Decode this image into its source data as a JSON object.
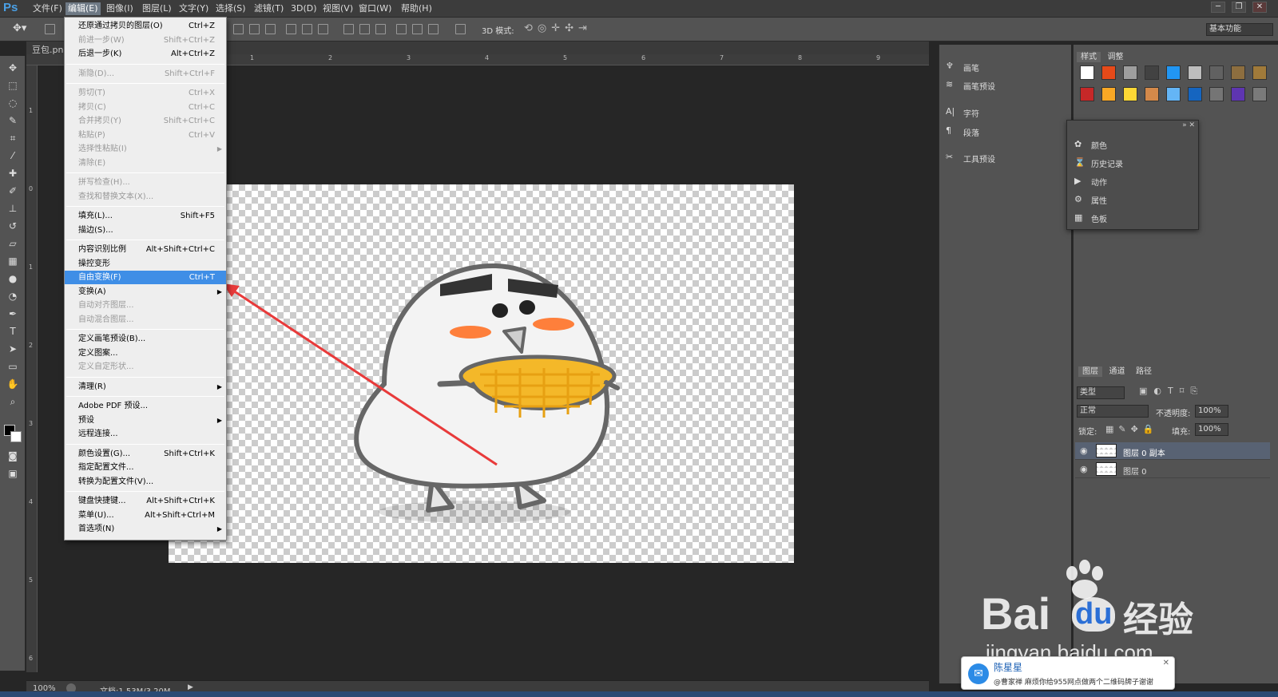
{
  "menubar": {
    "logo": "Ps",
    "items": [
      "文件(F)",
      "编辑(E)",
      "图像(I)",
      "图层(L)",
      "文字(Y)",
      "选择(S)",
      "滤镜(T)",
      "3D(D)",
      "视图(V)",
      "窗口(W)",
      "帮助(H)"
    ],
    "active_index": 1,
    "window_buttons": [
      "─",
      "❐",
      "✕"
    ]
  },
  "optbar": {
    "mode_label": "3D 模式:",
    "workspace": "基本功能"
  },
  "document": {
    "tab": "豆包.png",
    "zoom": "100%",
    "doc_info": "文档:1.53M/3.20M"
  },
  "ruler": {
    "top_marks": [
      "1",
      "2",
      "3",
      "4",
      "5",
      "6",
      "7",
      "8",
      "9"
    ],
    "left_marks": [
      "1",
      "0",
      "1",
      "2",
      "3",
      "4",
      "5",
      "6"
    ]
  },
  "edit_menu": {
    "items": [
      {
        "label": "还原通过拷贝的图层(O)",
        "shortcut": "Ctrl+Z",
        "enabled": true
      },
      {
        "label": "前进一步(W)",
        "shortcut": "Shift+Ctrl+Z",
        "enabled": false
      },
      {
        "label": "后退一步(K)",
        "shortcut": "Alt+Ctrl+Z",
        "enabled": true
      },
      {
        "label": "渐隐(D)...",
        "shortcut": "Shift+Ctrl+F",
        "enabled": false
      },
      {
        "label": "剪切(T)",
        "shortcut": "Ctrl+X",
        "enabled": false
      },
      {
        "label": "拷贝(C)",
        "shortcut": "Ctrl+C",
        "enabled": false
      },
      {
        "label": "合并拷贝(Y)",
        "shortcut": "Shift+Ctrl+C",
        "enabled": false
      },
      {
        "label": "粘贴(P)",
        "shortcut": "Ctrl+V",
        "enabled": false
      },
      {
        "label": "选择性粘贴(I)",
        "shortcut": "",
        "enabled": false,
        "submenu": true
      },
      {
        "label": "清除(E)",
        "shortcut": "",
        "enabled": false
      },
      {
        "label": "拼写检查(H)...",
        "shortcut": "",
        "enabled": false
      },
      {
        "label": "查找和替换文本(X)...",
        "shortcut": "",
        "enabled": false
      },
      {
        "label": "填充(L)...",
        "shortcut": "Shift+F5",
        "enabled": true
      },
      {
        "label": "描边(S)...",
        "shortcut": "",
        "enabled": true
      },
      {
        "label": "内容识别比例",
        "shortcut": "Alt+Shift+Ctrl+C",
        "enabled": true
      },
      {
        "label": "操控变形",
        "shortcut": "",
        "enabled": true
      },
      {
        "label": "自由变换(F)",
        "shortcut": "Ctrl+T",
        "enabled": true,
        "highlighted": true
      },
      {
        "label": "变换(A)",
        "shortcut": "",
        "enabled": true,
        "submenu": true
      },
      {
        "label": "自动对齐图层...",
        "shortcut": "",
        "enabled": false
      },
      {
        "label": "自动混合图层...",
        "shortcut": "",
        "enabled": false
      },
      {
        "label": "定义画笔预设(B)...",
        "shortcut": "",
        "enabled": true
      },
      {
        "label": "定义图案...",
        "shortcut": "",
        "enabled": true
      },
      {
        "label": "定义自定形状...",
        "shortcut": "",
        "enabled": false
      },
      {
        "label": "清理(R)",
        "shortcut": "",
        "enabled": true,
        "submenu": true
      },
      {
        "label": "Adobe PDF 预设...",
        "shortcut": "",
        "enabled": true
      },
      {
        "label": "预设",
        "shortcut": "",
        "enabled": true,
        "submenu": true
      },
      {
        "label": "远程连接...",
        "shortcut": "",
        "enabled": true
      },
      {
        "label": "颜色设置(G)...",
        "shortcut": "Shift+Ctrl+K",
        "enabled": true
      },
      {
        "label": "指定配置文件...",
        "shortcut": "",
        "enabled": true
      },
      {
        "label": "转换为配置文件(V)...",
        "shortcut": "",
        "enabled": true
      },
      {
        "label": "键盘快捷键...",
        "shortcut": "Alt+Shift+Ctrl+K",
        "enabled": true
      },
      {
        "label": "菜单(U)...",
        "shortcut": "Alt+Shift+Ctrl+M",
        "enabled": true
      },
      {
        "label": "首选项(N)",
        "shortcut": "",
        "enabled": true,
        "submenu": true
      }
    ]
  },
  "mid_panel": {
    "items": [
      "画笔",
      "画笔预设",
      "字符",
      "段落",
      "工具预设"
    ]
  },
  "styles_panel": {
    "tabs": [
      "样式",
      "调整"
    ]
  },
  "float_panel": {
    "items": [
      "颜色",
      "历史记录",
      "动作",
      "属性",
      "色板"
    ]
  },
  "layers_panel": {
    "tabs": [
      "图层",
      "通道",
      "路径"
    ],
    "filter": "类型",
    "blend_mode": "正常",
    "opacity_label": "不透明度:",
    "opacity": "100%",
    "lock_label": "锁定:",
    "fill_label": "填充:",
    "fill": "100%",
    "layers": [
      {
        "name": "图层 0 副本",
        "selected": true
      },
      {
        "name": "图层 0",
        "selected": false
      }
    ]
  },
  "notification": {
    "title": "陈星星",
    "body": "@曹家禅 麻烦你给955网点做两个二维码牌子谢谢",
    "close": "✕"
  },
  "watermark": {
    "brand": "Bai",
    "brand2": "du",
    "suffix": "经验",
    "url": "jingyan.baidu.com"
  },
  "colors": {
    "highlight": "#3f8ee6",
    "panel": "#535353",
    "workspace": "#262626",
    "arrow": "#e83a3a"
  }
}
